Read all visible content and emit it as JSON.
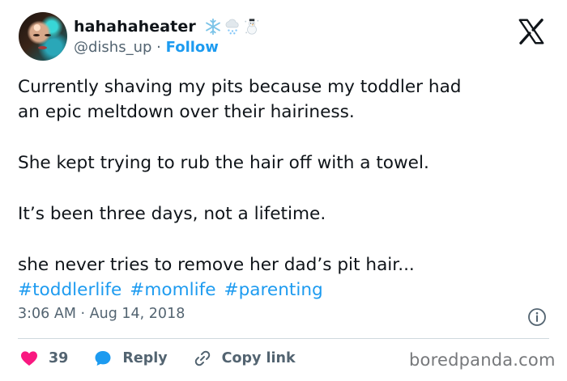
{
  "author": {
    "display_name": "hahahaheater",
    "handle": "@dishs_up",
    "separator": "·",
    "follow_label": "Follow",
    "emoji_icons": [
      "snowflake-emoji",
      "snow-cloud-emoji",
      "snowman-emoji"
    ]
  },
  "tweet": {
    "line1": "Currently shaving my pits because my toddler had",
    "line2": "an epic meltdown over their hairiness.",
    "line3": "She kept trying to rub the hair off with a towel.",
    "line4": "It’s been three days, not a lifetime.",
    "line5": "she never tries to remove her dad’s pit hair...",
    "hashtags": [
      "#toddlerlife",
      "#momlife",
      "#parenting"
    ]
  },
  "meta": {
    "time": "3:06 AM",
    "separator": "·",
    "date": "Aug 14, 2018"
  },
  "actions": {
    "like_count": "39",
    "reply_label": "Reply",
    "copy_link_label": "Copy link"
  },
  "watermark": "boredpanda.com",
  "colors": {
    "accent": "#1d9bf0",
    "like": "#f91880",
    "secondary_text": "#536471",
    "divider": "#cfd9de"
  }
}
